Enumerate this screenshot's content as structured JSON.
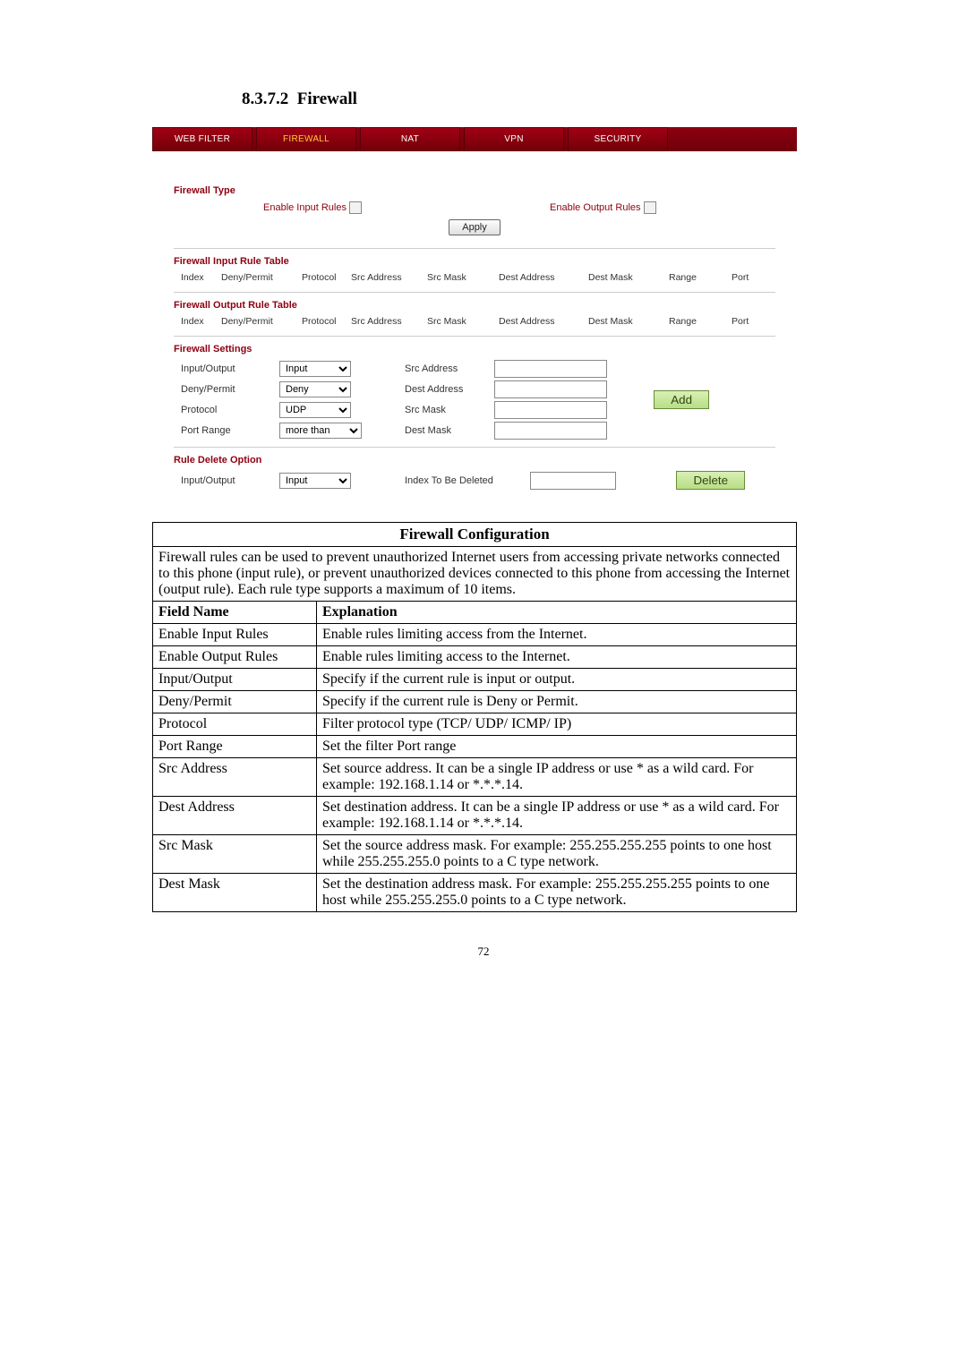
{
  "heading": {
    "number": "8.3.7.2",
    "title": "Firewall"
  },
  "tabs": [
    "WEB FILTER",
    "FIREWALL",
    "NAT",
    "VPN",
    "SECURITY"
  ],
  "firewall_type": {
    "title": "Firewall Type",
    "enable_input_label": "Enable Input Rules",
    "enable_output_label": "Enable Output Rules",
    "apply_label": "Apply"
  },
  "input_table": {
    "title": "Firewall Input Rule Table",
    "columns": [
      "Index",
      "Deny/Permit",
      "Protocol",
      "Src Address",
      "Src Mask",
      "Dest Address",
      "Dest Mask",
      "Range",
      "Port"
    ]
  },
  "output_table": {
    "title": "Firewall Output Rule Table",
    "columns": [
      "Index",
      "Deny/Permit",
      "Protocol",
      "Src Address",
      "Src Mask",
      "Dest Address",
      "Dest Mask",
      "Range",
      "Port"
    ]
  },
  "settings": {
    "title": "Firewall Settings",
    "labels": {
      "in_out": "Input/Output",
      "deny_permit": "Deny/Permit",
      "protocol": "Protocol",
      "port_range": "Port Range",
      "src_addr": "Src Address",
      "dest_addr": "Dest Address",
      "src_mask": "Src Mask",
      "dest_mask": "Dest Mask"
    },
    "values": {
      "in_out": "Input",
      "deny_permit": "Deny",
      "protocol": "UDP",
      "port_range": "more than"
    },
    "add_label": "Add"
  },
  "delete_opt": {
    "title": "Rule Delete Option",
    "in_out_label": "Input/Output",
    "in_out_value": "Input",
    "index_label": "Index To Be Deleted",
    "delete_label": "Delete"
  },
  "config": {
    "caption": "Firewall Configuration",
    "description": "Firewall rules can be used to prevent unauthorized Internet users from accessing private networks connected to this phone (input rule), or prevent unauthorized devices connected to this phone from accessing the Internet (output rule).   Each rule type supports a maximum of 10 items.",
    "head_field": "Field Name",
    "head_expl": "Explanation",
    "rows": [
      {
        "field": "Enable Input Rules",
        "expl": "Enable rules limiting access from the Internet."
      },
      {
        "field": "Enable Output Rules",
        "expl": "Enable rules limiting access to the Internet."
      },
      {
        "field": "Input/Output",
        "expl": "Specify if the current rule is input or output."
      },
      {
        "field": "Deny/Permit",
        "expl": "Specify if the current rule is Deny or Permit."
      },
      {
        "field": "Protocol",
        "expl": "Filter protocol type (TCP/ UDP/ ICMP/ IP)"
      },
      {
        "field": "Port Range",
        "expl": "Set the filter Port range"
      },
      {
        "field": "Src Address",
        "expl": "Set source address. It can be a single IP address or use * as a wild card. For example: 192.168.1.14 or   *.*.*.14."
      },
      {
        "field": "Dest Address",
        "expl": "Set destination address.   It can be a single IP address or use * as a wild card. For example: 192.168.1.14 or   *.*.*.14."
      },
      {
        "field": "Src Mask",
        "expl": "Set the source address mask. For example: 255.255.255.255 points to one host while 255.255.255.0 points to a C type network."
      },
      {
        "field": "Dest Mask",
        "expl": "Set the destination address mask. For example: 255.255.255.255 points to one host while 255.255.255.0 points to a C type network."
      }
    ]
  },
  "page_number": "72"
}
